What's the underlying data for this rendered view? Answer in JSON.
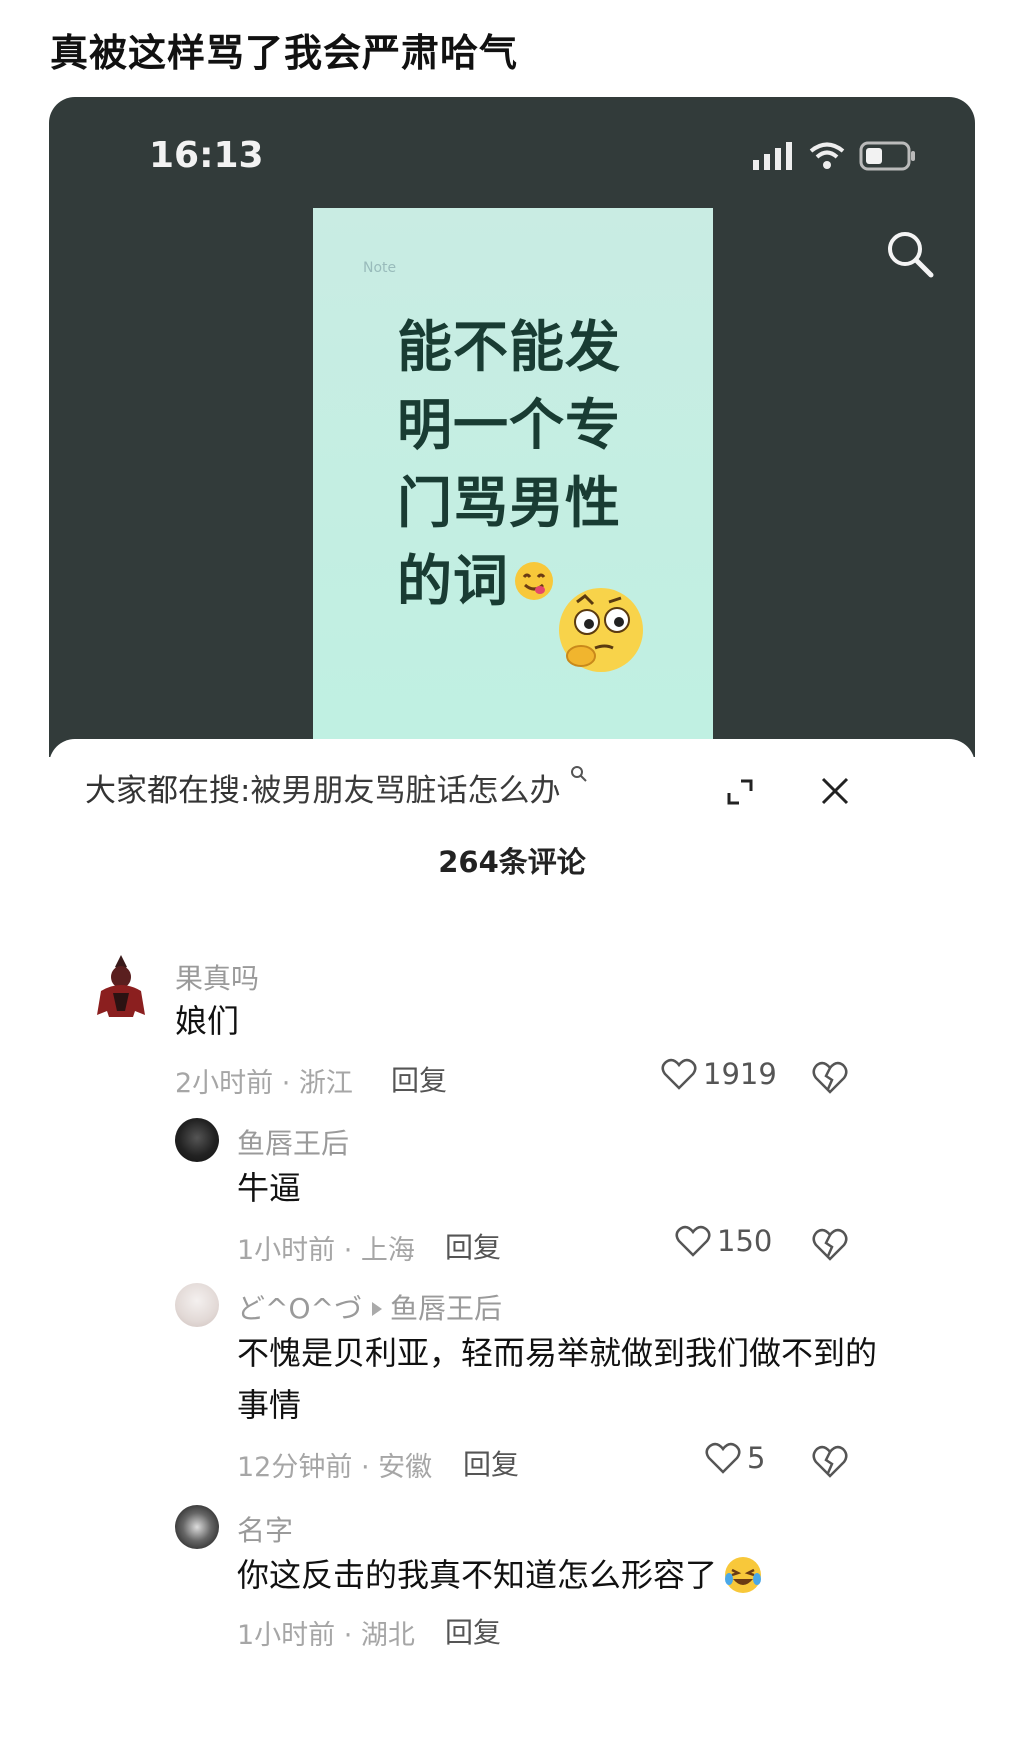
{
  "post_title": "真被这样骂了我会严肃哈气",
  "status_bar": {
    "time": "16:13"
  },
  "poster": {
    "brand": "Note",
    "lines": [
      "能不能发",
      "明一个专",
      "门骂男性",
      "的词"
    ]
  },
  "panel": {
    "hot_search_prefix": "大家都在搜:",
    "hot_search_query": "被男朋友骂脏话怎么办",
    "comment_count": "264条评论"
  },
  "comments": [
    {
      "user": "果真吗",
      "text": "娘们",
      "meta": "2小时前 · 浙江",
      "reply": "回复",
      "likes": "1919"
    },
    {
      "user": "鱼唇王后",
      "text": "牛逼",
      "meta": "1小时前 · 上海",
      "reply": "回复",
      "likes": "150"
    },
    {
      "user": "ど^O^づ",
      "reply_to": "鱼唇王后",
      "text": "不愧是贝利亚，轻而易举就做到我们做不到的事情",
      "meta": "12分钟前 · 安徽",
      "reply": "回复",
      "likes": "5"
    },
    {
      "user": "名字",
      "text": "你这反击的我真不知道怎么形容了",
      "meta": "1小时前 · 湖北",
      "reply": "回复"
    }
  ]
}
